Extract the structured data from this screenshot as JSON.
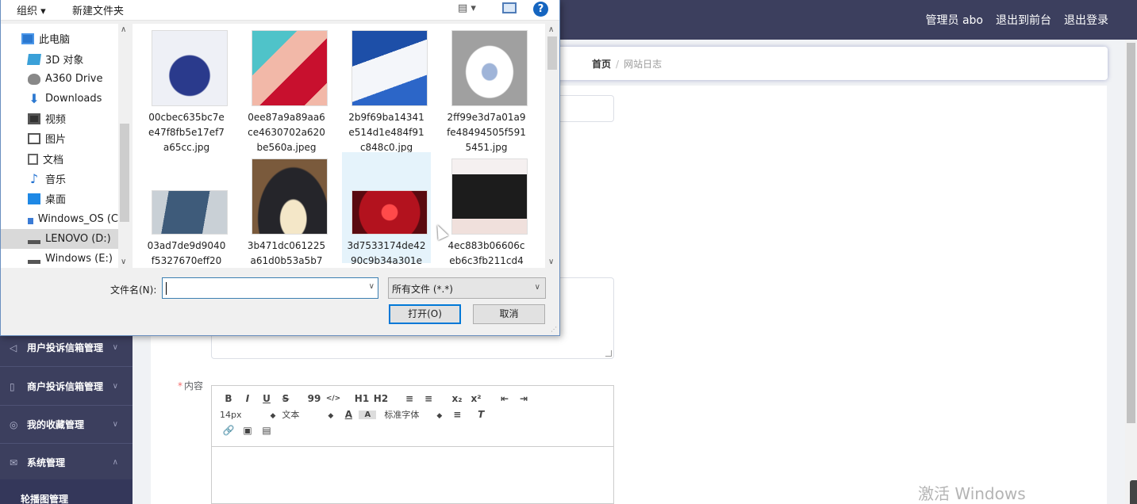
{
  "topbar": {
    "admin": "管理员 abo",
    "exit_front": "退出到前台",
    "logout": "退出登录"
  },
  "breadcrumb": {
    "home": "首页",
    "sep": "/",
    "current": "网站日志"
  },
  "form": {
    "content_label": "内容",
    "required_mark": "*"
  },
  "editor": {
    "row1": [
      "B",
      "I",
      "U",
      "S",
      "99",
      "</>",
      "H1",
      "H2",
      "≡",
      "≡",
      "x₂",
      "x²",
      "⇤",
      "⇥"
    ],
    "font_size": "14px",
    "text_style": "文本",
    "font_family": "标准字体"
  },
  "sidebar": {
    "items": [
      {
        "label": "用户投诉信箱管理",
        "icon": "send-icon"
      },
      {
        "label": "商户投诉信箱管理",
        "icon": "phone-icon"
      },
      {
        "label": "我的收藏管理",
        "icon": "compass-icon"
      },
      {
        "label": "系统管理",
        "icon": "mail-icon"
      }
    ],
    "sub_item": "轮播图管理"
  },
  "watermark": "激活 Windows",
  "dialog": {
    "toolbar": {
      "organize": "组织 ▾",
      "new_folder": "新建文件夹",
      "view": "▤ ▾",
      "help": "?"
    },
    "nav": [
      {
        "label": "此电脑",
        "icon": "pc-icon"
      },
      {
        "label": "3D 对象",
        "icon": "3d-icon"
      },
      {
        "label": "A360 Drive",
        "icon": "cloud-icon"
      },
      {
        "label": "Downloads",
        "icon": "download-icon"
      },
      {
        "label": "视频",
        "icon": "video-icon"
      },
      {
        "label": "图片",
        "icon": "picture-icon"
      },
      {
        "label": "文档",
        "icon": "document-icon"
      },
      {
        "label": "音乐",
        "icon": "music-icon"
      },
      {
        "label": "桌面",
        "icon": "desktop-icon"
      },
      {
        "label": "Windows_OS (C",
        "icon": "os-drive-icon"
      },
      {
        "label": "LENOVO (D:)",
        "icon": "drive-icon"
      },
      {
        "label": "Windows (E:)",
        "icon": "drive-icon"
      }
    ],
    "files": [
      {
        "name": "00cbec635bc7ee47f8fb5e17ef7a65cc.jpg",
        "thumb": "navy-handbag"
      },
      {
        "name": "0ee87a9a89aa6ce4630702a620be560a.jpeg",
        "thumb": "red-nail-polish"
      },
      {
        "name": "2b9f69ba14341e514d1e484f91c848c0.jpg",
        "thumb": "white-sneakers"
      },
      {
        "name": "2ff99e3d7a01a9fe48494505f5915451.jpg",
        "thumb": "white-tshirt"
      },
      {
        "name": "03ad7de9d9040f5327670eff20",
        "thumb": "smartphone"
      },
      {
        "name": "3b471dc061225a61d0b53a5b7",
        "thumb": "high-top-sneakers"
      },
      {
        "name": "3d7533174de4290c9b34a301e",
        "thumb": "red-lipstick-set"
      },
      {
        "name": "4ec883b06606ceb6c3fb211cd4",
        "thumb": "black-tshirt-model"
      }
    ],
    "filename_label": "文件名(N):",
    "filename_value": "",
    "filter": "所有文件 (*.*)",
    "open_button": "打开(O)",
    "cancel_button": "取消"
  },
  "colors": {
    "topbar": "#3c3f5e",
    "accent": "#0078d7",
    "dialog_border": "#6a8fbf"
  }
}
